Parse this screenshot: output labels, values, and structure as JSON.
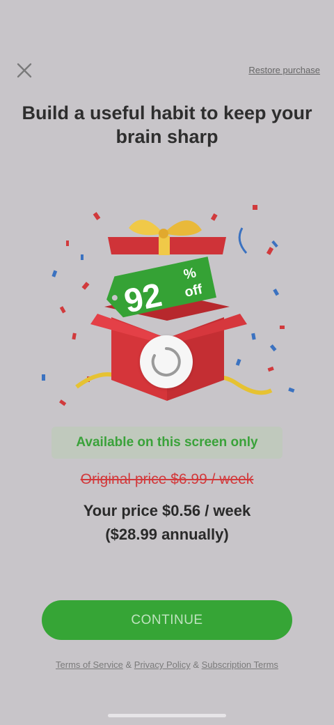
{
  "header": {
    "close_icon": "close-icon",
    "restore_label": "Restore purchase"
  },
  "title": "Build a useful habit to keep your brain sharp",
  "hero": {
    "discount_value": "92",
    "discount_percent": "%",
    "discount_off": "off",
    "icons": [
      "gift-box-illustration",
      "confetti",
      "loading-spinner-icon"
    ]
  },
  "offer": {
    "badge": "Available on this screen only",
    "original_price": "Original price $6.99 / week",
    "your_price_line1": "Your price $0.56 / week",
    "your_price_line2": "($28.99 annually)"
  },
  "cta": {
    "continue_label": "CONTINUE"
  },
  "footer": {
    "terms": "Terms of Service",
    "sep1": "&",
    "privacy": "Privacy Policy",
    "sep2": "&",
    "subscription": "Subscription Terms"
  },
  "colors": {
    "background": "#c8c5c9",
    "accent_green": "#36a536",
    "price_red": "#d3393b"
  }
}
